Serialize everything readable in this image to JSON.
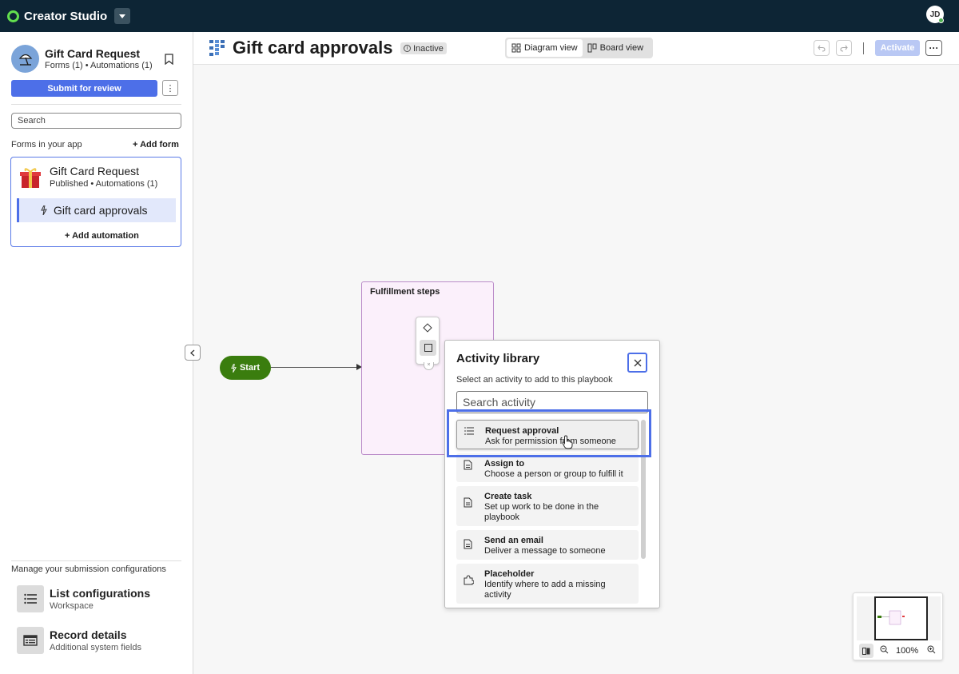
{
  "topbar": {
    "brand": "Creator Studio",
    "avatar_initials": "JD"
  },
  "sidebar": {
    "app_title": "Gift Card Request",
    "app_subtitle": "Forms (1) • Automations (1)",
    "submit_label": "Submit for review",
    "search_placeholder": "Search",
    "forms_label": "Forms in your app",
    "add_form_label": "+ Add form",
    "form": {
      "title": "Gift Card Request",
      "subtitle": "Published • Automations (1)",
      "automation_label": "Gift card approvals",
      "add_automation_label": "+ Add automation"
    },
    "manage_label": "Manage your submission configurations",
    "configs": [
      {
        "title": "List configurations",
        "subtitle": "Workspace",
        "icon": "list-icon"
      },
      {
        "title": "Record details",
        "subtitle": "Additional system fields",
        "icon": "record-icon"
      }
    ]
  },
  "header": {
    "title": "Gift card approvals",
    "status": "Inactive",
    "views": [
      {
        "label": "Diagram view",
        "active": true
      },
      {
        "label": "Board view",
        "active": false
      }
    ],
    "activate_label": "Activate",
    "more_label": "···"
  },
  "canvas": {
    "start_label": "Start",
    "group_title": "Fulfillment steps"
  },
  "activity_library": {
    "title": "Activity library",
    "subtitle": "Select an activity to add to this playbook",
    "search_placeholder": "Search activity",
    "items": [
      {
        "title": "Request approval",
        "desc": "Ask for permission from someone",
        "icon": "list-icon"
      },
      {
        "title": "Assign to",
        "desc": "Choose a person or group to fulfill it",
        "icon": "document-icon"
      },
      {
        "title": "Create task",
        "desc": "Set up work to be done in the playbook",
        "icon": "document-icon"
      },
      {
        "title": "Send an email",
        "desc": "Deliver a message to someone",
        "icon": "document-icon"
      },
      {
        "title": "Placeholder",
        "desc": "Identify where to add a missing activity",
        "icon": "puzzle-icon"
      }
    ]
  },
  "minimap": {
    "zoom": "100%"
  },
  "colors": {
    "accent": "#4d6fe8",
    "topbar": "#0d2535",
    "start": "#3a7d0e",
    "group_border": "#bb8cc9"
  }
}
